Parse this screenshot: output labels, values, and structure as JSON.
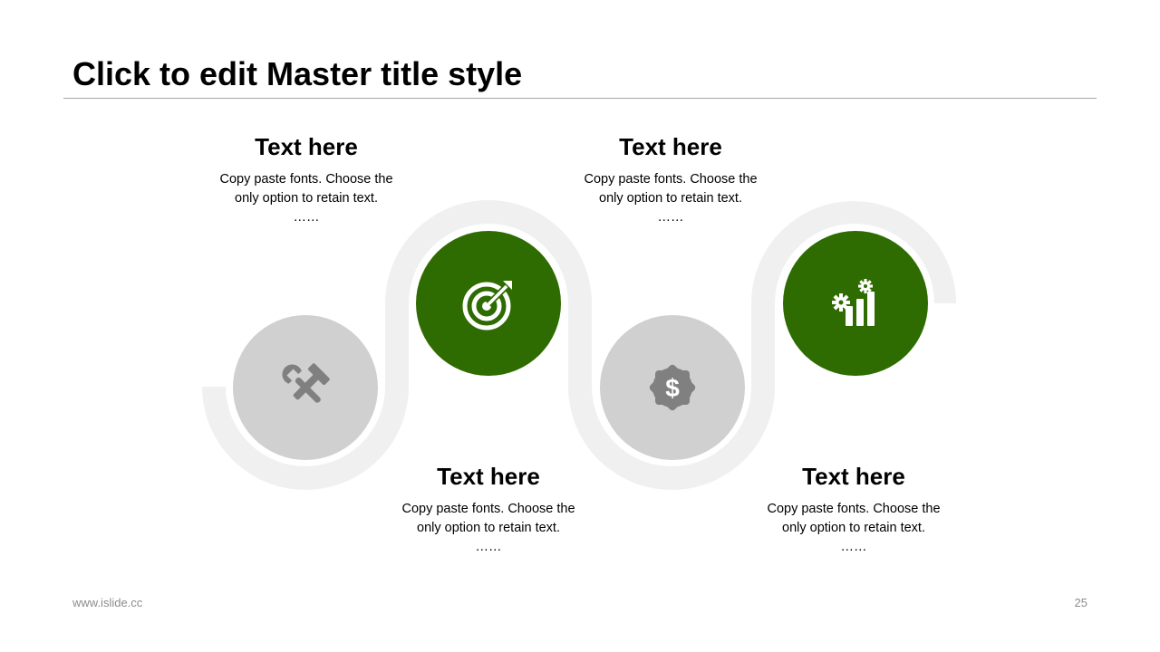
{
  "title": "Click to edit Master title style",
  "colors": {
    "accent": "#2e6b00",
    "inactive": "#d0d0d0",
    "track": "#f0f0f0",
    "icon_inactive": "#808080",
    "icon_active": "#ffffff"
  },
  "steps": [
    {
      "heading": "Text here",
      "line1": "Copy paste fonts. Choose the",
      "line2": "only option to retain text.",
      "dots": "……",
      "icon": "tools-icon"
    },
    {
      "heading": "Text here",
      "line1": "Copy paste fonts. Choose the",
      "line2": "only option to retain text.",
      "dots": "……",
      "icon": "target-icon"
    },
    {
      "heading": "Text here",
      "line1": "Copy paste fonts. Choose the",
      "line2": "only option to retain text.",
      "dots": "……",
      "icon": "dollar-badge-icon"
    },
    {
      "heading": "Text here",
      "line1": "Copy paste fonts. Choose the",
      "line2": "only option to retain text.",
      "dots": "……",
      "icon": "chart-gears-icon"
    }
  ],
  "footer": {
    "website": "www.islide.cc",
    "page_number": "25"
  }
}
